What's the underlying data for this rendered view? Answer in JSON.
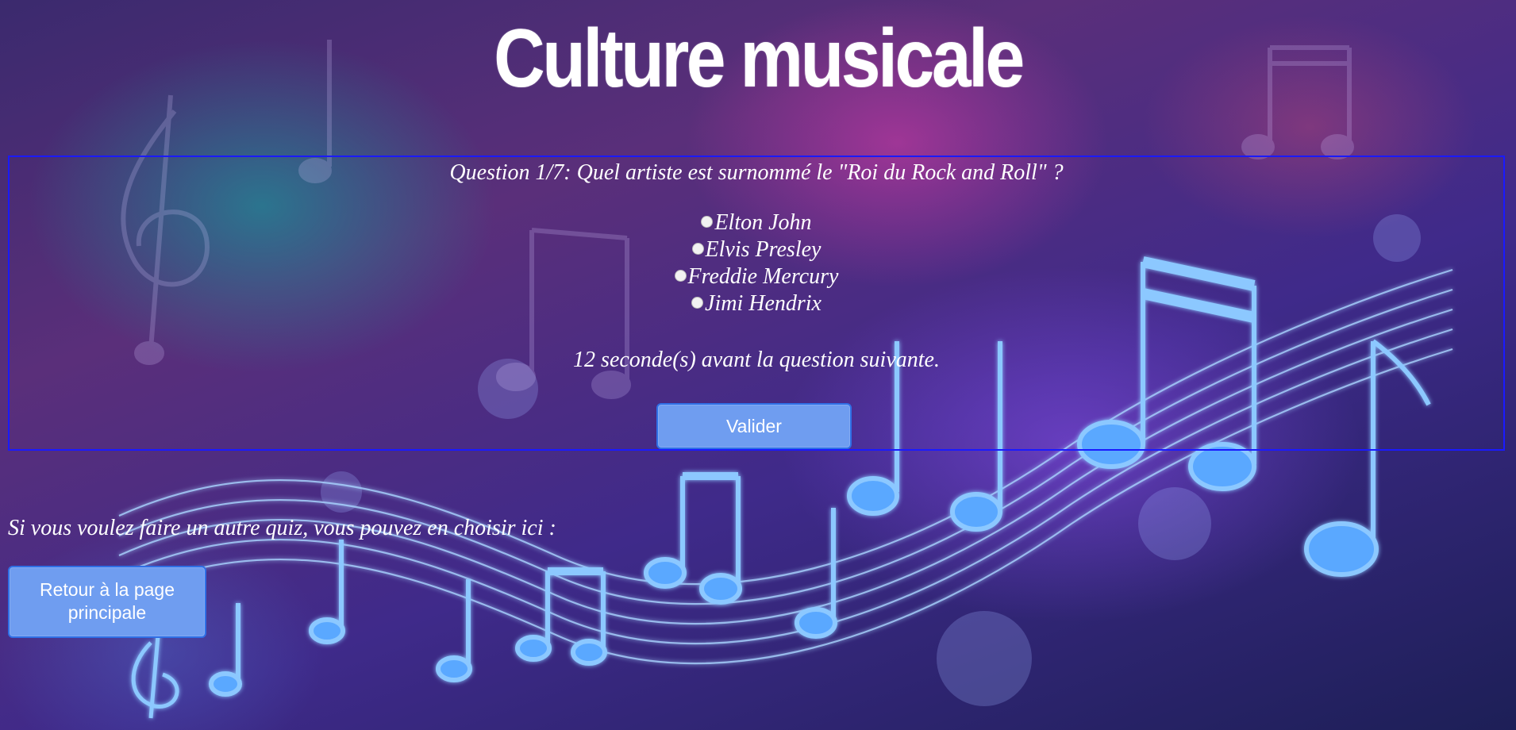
{
  "page": {
    "title": "Culture musicale"
  },
  "quiz": {
    "question": "Question 1/7: Quel artiste est surnommé le \"Roi du Rock and Roll\" ?",
    "answers": [
      {
        "label": "Elton John"
      },
      {
        "label": "Elvis Presley"
      },
      {
        "label": "Freddie Mercury"
      },
      {
        "label": "Jimi Hendrix"
      }
    ],
    "timer_text": "12 seconde(s) avant la question suivante.",
    "validate_label": "Valider"
  },
  "footer": {
    "other_quiz_text": "Si vous voulez faire un autre quiz, vous pouvez en choisir ici :",
    "home_button_label": "Retour à la page principale"
  },
  "colors": {
    "quiz_border": "#1a1aff",
    "button_fill": "#6f9df0",
    "button_border": "#2f6fe6",
    "text": "#ffffff"
  },
  "icons": [
    "radio-button-icon",
    "music-notes-background"
  ]
}
